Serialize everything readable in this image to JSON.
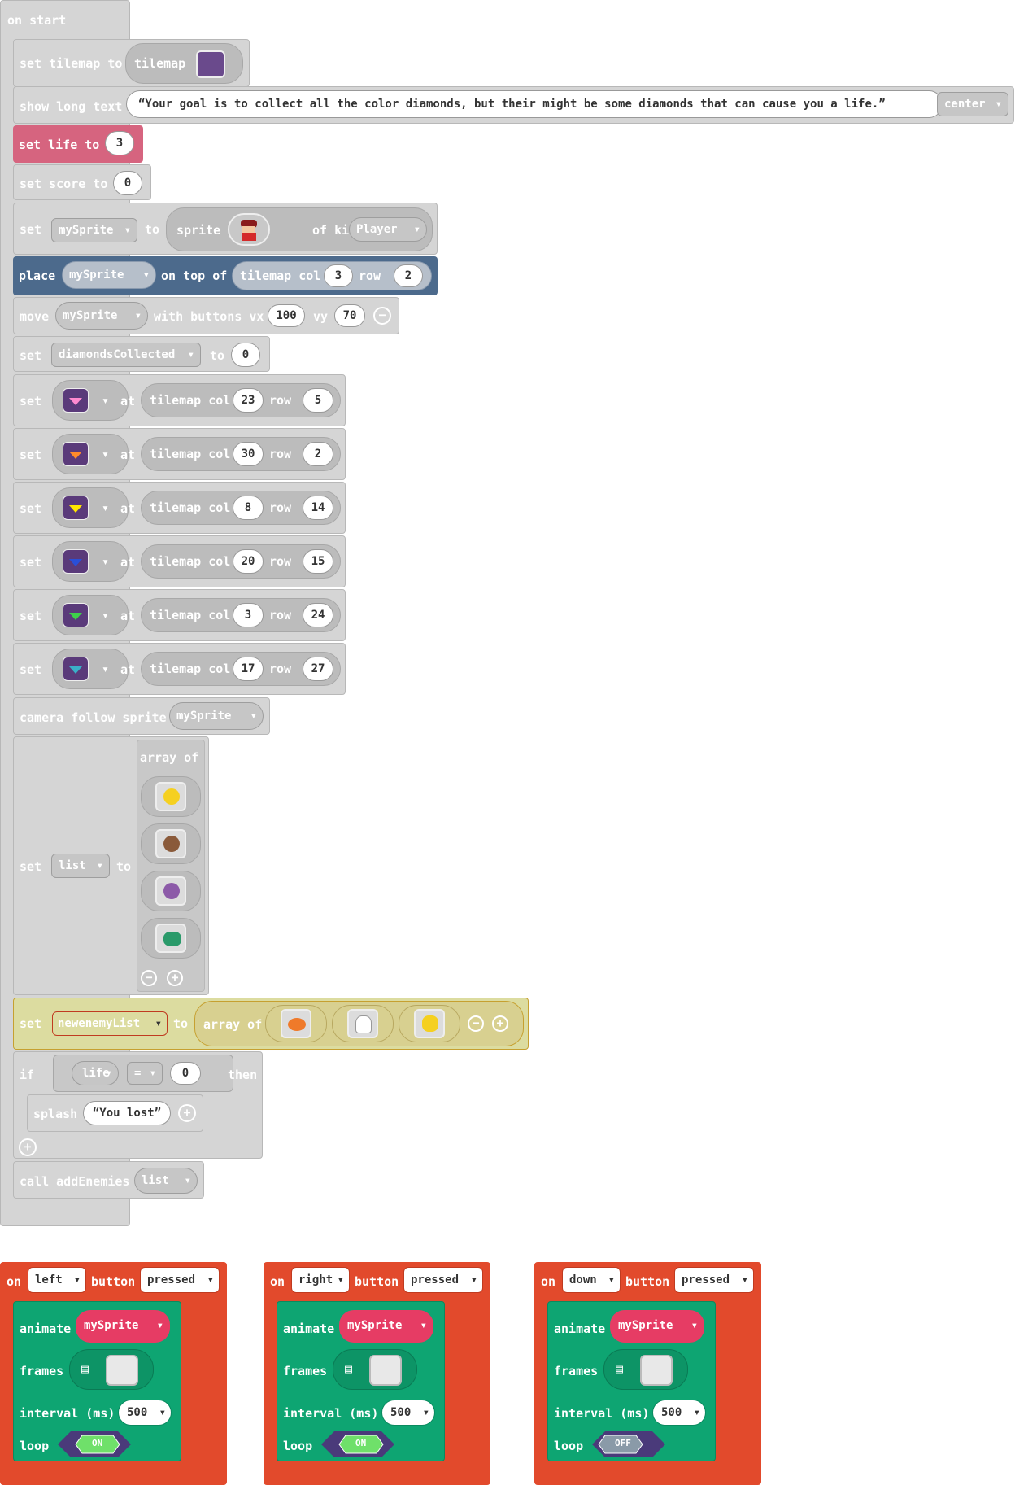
{
  "on_start": {
    "header": "on start",
    "tilemap": {
      "set": "set tilemap to",
      "value": "tilemap"
    },
    "long_text": {
      "label": "show long text",
      "text": "Your goal is to collect all the color diamonds, but their might be some diamonds that can cause you a life.",
      "align": "center"
    },
    "life": {
      "label": "set life to",
      "value": "3"
    },
    "score": {
      "label": "set score to",
      "value": "0"
    },
    "sprite": {
      "set": "set",
      "var": "mySprite",
      "to": "to",
      "sprite": "sprite",
      "of_kind": "of kind",
      "kind": "Player"
    },
    "place": {
      "label": "place",
      "var": "mySprite",
      "on_top_of": "on top of",
      "tilemap_col": "tilemap col",
      "col": "3",
      "row_label": "row",
      "row": "2"
    },
    "move": {
      "label": "move",
      "var": "mySprite",
      "with_buttons": "with buttons vx",
      "vx": "100",
      "vy_label": "vy",
      "vy": "70"
    },
    "diamonds_var": {
      "set": "set",
      "var": "diamondsCollected",
      "to": "to",
      "value": "0"
    },
    "tiles": [
      {
        "set": "set",
        "at": "at",
        "tilemap_col": "tilemap col",
        "col": "23",
        "row_label": "row",
        "row": "5",
        "color": "#ff8ad0"
      },
      {
        "set": "set",
        "at": "at",
        "tilemap_col": "tilemap col",
        "col": "30",
        "row_label": "row",
        "row": "2",
        "color": "#ff8a2a"
      },
      {
        "set": "set",
        "at": "at",
        "tilemap_col": "tilemap col",
        "col": "8",
        "row_label": "row",
        "row": "14",
        "color": "#ffe600"
      },
      {
        "set": "set",
        "at": "at",
        "tilemap_col": "tilemap col",
        "col": "20",
        "row_label": "row",
        "row": "15",
        "color": "#2a4fd8"
      },
      {
        "set": "set",
        "at": "at",
        "tilemap_col": "tilemap col",
        "col": "3",
        "row_label": "row",
        "row": "24",
        "color": "#3ecf4a"
      },
      {
        "set": "set",
        "at": "at",
        "tilemap_col": "tilemap col",
        "col": "17",
        "row_label": "row",
        "row": "27",
        "color": "#3ab0c8"
      }
    ],
    "camera": {
      "label": "camera follow sprite",
      "var": "mySprite"
    },
    "list": {
      "set": "set",
      "var": "list",
      "to": "to",
      "array_of": "array of",
      "items": [
        "duck",
        "monkey",
        "bat",
        "snake"
      ]
    },
    "enemy_list": {
      "set": "set",
      "var": "newenemyList",
      "to": "to",
      "array_of": "array of",
      "items": [
        "clownfish",
        "ghost",
        "cat"
      ]
    },
    "if_block": {
      "if": "if",
      "var": "life",
      "op": "=",
      "value": "0",
      "then": "then",
      "splash": "splash",
      "splash_text": "You lost"
    },
    "call": {
      "label": "call addEnemies",
      "arg": "list"
    }
  },
  "button_events": [
    {
      "on": "on",
      "button": "left",
      "button_label": "button",
      "event": "pressed",
      "animate": "animate",
      "var": "mySprite",
      "frames": "frames",
      "interval_label": "interval (ms)",
      "interval": "500",
      "loop": "loop",
      "loop_state": "ON"
    },
    {
      "on": "on",
      "button": "right",
      "button_label": "button",
      "event": "pressed",
      "animate": "animate",
      "var": "mySprite",
      "frames": "frames",
      "interval_label": "interval (ms)",
      "interval": "500",
      "loop": "loop",
      "loop_state": "ON"
    },
    {
      "on": "on",
      "button": "down",
      "button_label": "button",
      "event": "pressed",
      "animate": "animate",
      "var": "mySprite",
      "frames": "frames",
      "interval_label": "interval (ms)",
      "interval": "500",
      "loop": "loop",
      "loop_state": "OFF"
    }
  ],
  "colors": {
    "gray_block": "#d5d5d5",
    "life_block": "#d6647f",
    "place_block": "#4c6a8c",
    "event_block": "#e24a2c",
    "animation_block": "#0ea572",
    "variable_pill": "#e63c64"
  }
}
